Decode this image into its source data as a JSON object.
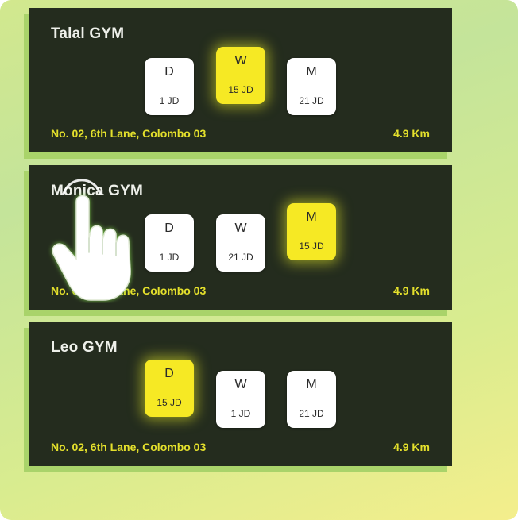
{
  "gyms": [
    {
      "name": "Talal GYM",
      "address": "No. 02, 6th Lane, Colombo 03",
      "distance": "4.9 Km",
      "plans": [
        {
          "code": "D",
          "price": "1 JD",
          "selected": false
        },
        {
          "code": "W",
          "price": "15 JD",
          "selected": true
        },
        {
          "code": "M",
          "price": "21 JD",
          "selected": false
        }
      ]
    },
    {
      "name": "Monica GYM",
      "address": "No. 02, 6th Lane, Colombo 03",
      "distance": "4.9 Km",
      "plans": [
        {
          "code": "D",
          "price": "1 JD",
          "selected": false
        },
        {
          "code": "W",
          "price": "21 JD",
          "selected": false
        },
        {
          "code": "M",
          "price": "15 JD",
          "selected": true
        }
      ]
    },
    {
      "name": "Leo GYM",
      "address": "No. 02, 6th Lane, Colombo 03",
      "distance": "4.9 Km",
      "plans": [
        {
          "code": "D",
          "price": "15 JD",
          "selected": true
        },
        {
          "code": "W",
          "price": "1 JD",
          "selected": false
        },
        {
          "code": "M",
          "price": "21 JD",
          "selected": false
        }
      ]
    }
  ],
  "colors": {
    "card_background": "#242c1e",
    "accent_yellow": "#f6e924",
    "address_text": "#e4e02c",
    "card_shadow_green": "#a9d36a"
  },
  "icons": {
    "pointer": "tap-hand-icon"
  }
}
